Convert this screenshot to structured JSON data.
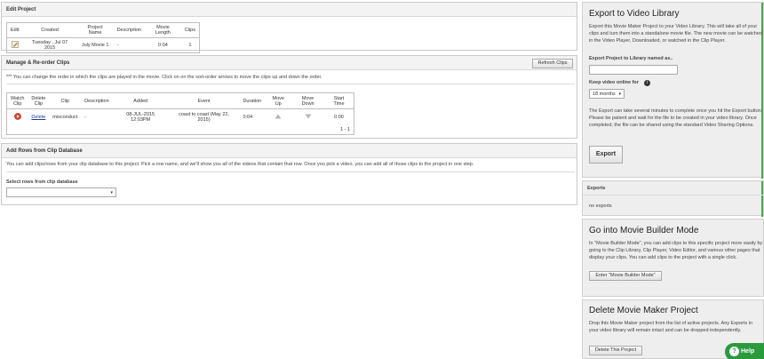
{
  "edit_project": {
    "title": "Edit Project",
    "headers": [
      "Edit",
      "Created",
      "Project Name",
      "Description",
      "Movie Length",
      "Clips"
    ],
    "row": {
      "created": "Tuesday , Jul 07 2015",
      "name": "July Movie 1",
      "description": "-",
      "length": "0:04",
      "clips": "1"
    }
  },
  "manage_clips": {
    "title": "Manage & Re-order Clips",
    "refresh_label": "Refresh Clips",
    "note": "*** You can change the order in which the clips are played in the movie. Click on on the sort-order arrows to move the clips up and down the order.",
    "headers": [
      [
        "Watch",
        "Clip"
      ],
      [
        "Delete",
        "Clip"
      ],
      [
        "Clip"
      ],
      [
        "Description"
      ],
      [
        "Added"
      ],
      [
        "Event"
      ],
      [
        "Duration"
      ],
      [
        "Move Up"
      ],
      [
        "Move Down"
      ],
      [
        "Start Time"
      ]
    ],
    "row": {
      "delete": "Delete",
      "clip": "misconduct",
      "description": "-",
      "added": "08-JUL-2015 12:03PM",
      "event": "coast to coast (May 22, 2015)",
      "duration": "0:04",
      "start": "0:00"
    },
    "pager": "1 - 1"
  },
  "add_rows": {
    "title": "Add Rows from Clip Database",
    "note": "You can add clips/rows from your clip database to this project. Pick a row name, and we'll show you all of the videos that contain that row. Once you pick a video, you can add all of those clips to the project in one step.",
    "select_label": "Select rows from clip database",
    "select_value": ""
  },
  "export": {
    "title": "Export to Video Library",
    "intro": "Export this Movie Maker Project to your Video Library. This will take all of your clips and turn them into a standalone movie file. The new movie can be watched in the Video Player, Downloaded, or watched in the Clip Player.",
    "name_label": "Export Project to Library named as..",
    "name_value": "",
    "keep_label": "Keep video online for",
    "keep_value": "18 months",
    "note": "The Export can take several minutes to complete once you hit the Export button. Please be patient and wait for the file to be created in your video library. Once completed, the file can be shared using the standard Video Sharing Options.",
    "button": "Export"
  },
  "exports": {
    "title": "Exports",
    "empty": "no exports"
  },
  "builder": {
    "title": "Go into Movie Builder Mode",
    "text": "In \"Movie Builder Mode\", you can add clips to this specific project more easily by going to the Clip Library, Clip Player, Video Editor, and various other pages that display your clips. You can add clips to the project with a single click.",
    "button": "Enter \"Movie Builder Mode\""
  },
  "delete_project": {
    "title": "Delete Movie Maker Project",
    "text": "Drop this Movie Maker project from the list of active projects. Any Exports in your video library will remain intact and can be dropped independently.",
    "button": "Delete This Project"
  },
  "help": {
    "label": "Help",
    "glyph": "?"
  }
}
